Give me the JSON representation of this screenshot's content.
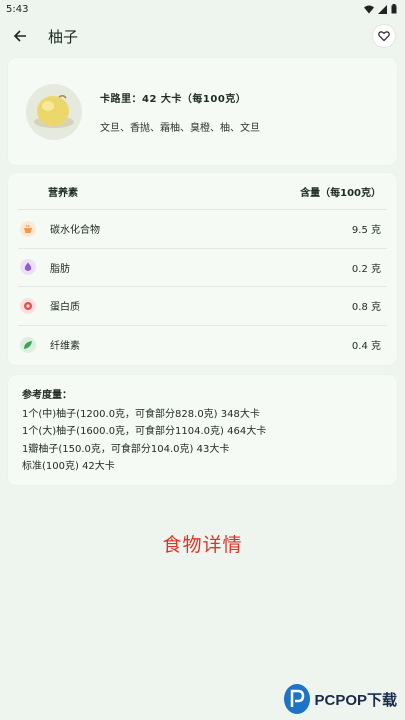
{
  "status": {
    "time": "5:43"
  },
  "app_bar": {
    "title": "柚子"
  },
  "food": {
    "calorie_text": "卡路里：42 大卡（每100克）",
    "aliases": "文旦、香抛、霜柚、臭橙、柚、文旦"
  },
  "nutrition": {
    "header_name": "营养素",
    "header_amount": "含量（每100克）",
    "rows": [
      {
        "name": "碳水化合物",
        "value": "9.5 克",
        "icon": "carbohydrate-icon",
        "color": "#f2994a"
      },
      {
        "name": "脂肪",
        "value": "0.2 克",
        "icon": "fat-icon",
        "color": "#8e5bd6"
      },
      {
        "name": "蛋白质",
        "value": "0.8 克",
        "icon": "protein-icon",
        "color": "#e2504c"
      },
      {
        "name": "纤维素",
        "value": "0.4 克",
        "icon": "fiber-icon",
        "color": "#3aa655"
      }
    ]
  },
  "reference": {
    "title": "参考度量：",
    "lines": [
      "1个(中)柚子(1200.0克，可食部分828.0克) 348大卡",
      "1个(大)柚子(1600.0克，可食部分1104.0克) 464大卡",
      "1瓣柚子(150.0克，可食部分104.0克) 43大卡",
      "标准(100克) 42大卡"
    ]
  },
  "detail_label": "食物详情",
  "watermark": {
    "brand": "PCPOP下载"
  }
}
